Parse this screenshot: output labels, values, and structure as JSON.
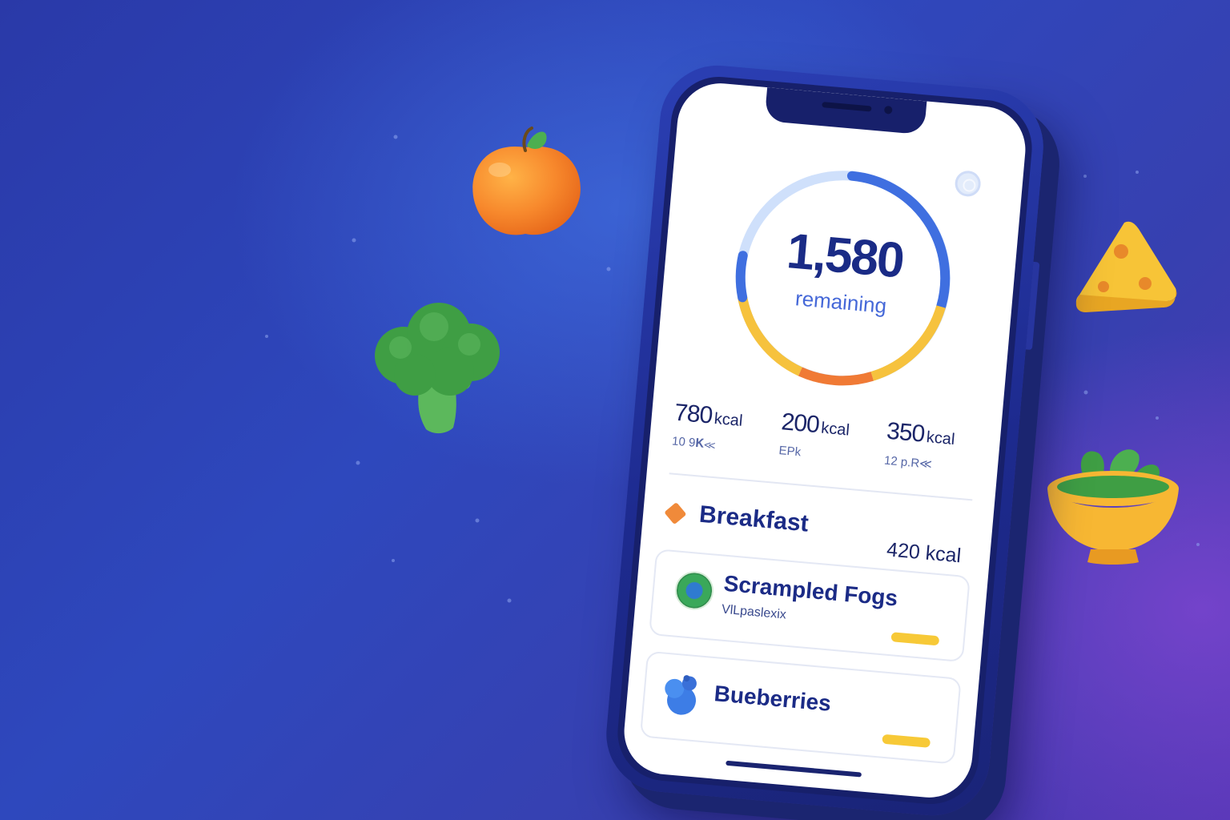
{
  "summary": {
    "remaining_value": "1,580",
    "remaining_label": "remaining"
  },
  "stats": [
    {
      "value": "780",
      "unit": "kcal",
      "sub": "10 9𝐊≪"
    },
    {
      "value": "200",
      "unit": "kcal",
      "sub": "EPk"
    },
    {
      "value": "350",
      "unit": "kcal",
      "sub": "12 p.R≪"
    }
  ],
  "meal": {
    "title": "Breakfast",
    "kcal": "420 kcal",
    "items": [
      {
        "name": "Scrampled Fogs",
        "sub": "VlLpaslexix",
        "icon": "egg-plate-icon"
      },
      {
        "name": "Bueberries",
        "sub": "",
        "icon": "blueberries-icon"
      }
    ]
  },
  "colors": {
    "accent_blue": "#4568d8",
    "ring_blue": "#3f6fe0",
    "ring_yellow": "#f6c23d",
    "ring_orange": "#f07a35",
    "ring_track": "#cfe0fb",
    "text_dark": "#1b2b86"
  },
  "decorations": [
    "orange-icon",
    "broccoli-icon",
    "cheese-icon",
    "salad-bowl-icon"
  ]
}
